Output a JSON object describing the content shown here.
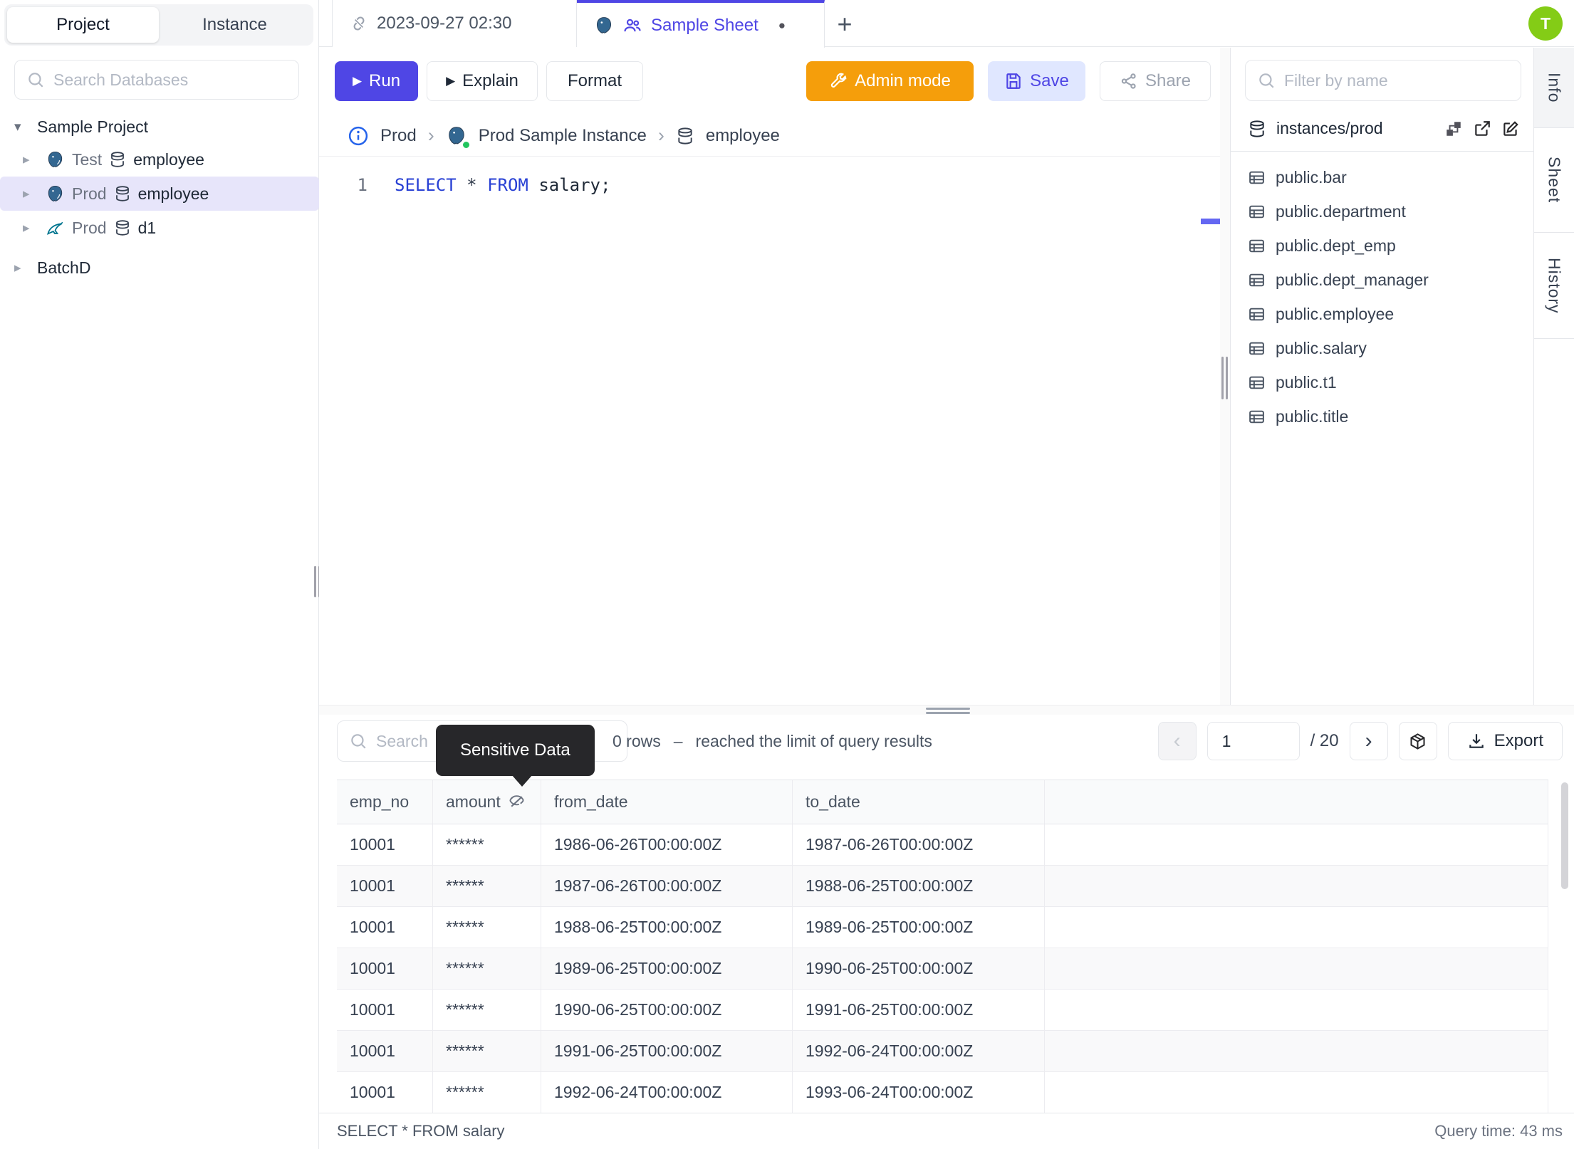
{
  "icons": {
    "play": "▶",
    "plus": "+",
    "caret_down": "▾",
    "caret_right": "▸",
    "chevron": "›",
    "prev": "‹",
    "next": "›",
    "dot": "●"
  },
  "user": {
    "initial": "T"
  },
  "left_sidebar": {
    "tabs": {
      "project": "Project",
      "instance": "Instance"
    },
    "search_placeholder": "Search Databases",
    "tree": {
      "project_label": "Sample Project",
      "items": [
        {
          "engine": "postgresql",
          "env": "Test",
          "db": "employee"
        },
        {
          "engine": "postgresql",
          "env": "Prod",
          "db": "employee"
        },
        {
          "engine": "mysql",
          "env": "Prod",
          "db": "d1"
        }
      ],
      "batch_label": "BatchD"
    }
  },
  "tab_bar": {
    "tab1": {
      "label": "2023-09-27 02:30"
    },
    "tab2": {
      "label": "Sample Sheet"
    }
  },
  "toolbar": {
    "run": "Run",
    "explain": "Explain",
    "format": "Format",
    "admin_mode": "Admin mode",
    "save": "Save",
    "share": "Share"
  },
  "breadcrumb": {
    "env": "Prod",
    "instance": "Prod Sample Instance",
    "database": "employee"
  },
  "editor": {
    "line_number": "1",
    "kw1": "SELECT",
    "star": "*",
    "kw2": "FROM",
    "rest": "salary;"
  },
  "right_sidebar": {
    "filter_placeholder": "Filter by name",
    "scope": "instances/prod",
    "tables": [
      "public.bar",
      "public.department",
      "public.dept_emp",
      "public.dept_manager",
      "public.employee",
      "public.salary",
      "public.t1",
      "public.title"
    ]
  },
  "side_tabs": {
    "info": "Info",
    "sheet": "Sheet",
    "history": "History"
  },
  "results": {
    "search_placeholder": "Search",
    "tooltip": "Sensitive Data",
    "row_count": "0 rows",
    "dash": "–",
    "limit_note": "reached the limit of query results",
    "page": "1",
    "page_total": "/ 20",
    "export_label": "Export",
    "columns": [
      "emp_no",
      "amount",
      "from_date",
      "to_date"
    ],
    "rows": [
      [
        "10001",
        "******",
        "1986-06-26T00:00:00Z",
        "1987-06-26T00:00:00Z"
      ],
      [
        "10001",
        "******",
        "1987-06-26T00:00:00Z",
        "1988-06-25T00:00:00Z"
      ],
      [
        "10001",
        "******",
        "1988-06-25T00:00:00Z",
        "1989-06-25T00:00:00Z"
      ],
      [
        "10001",
        "******",
        "1989-06-25T00:00:00Z",
        "1990-06-25T00:00:00Z"
      ],
      [
        "10001",
        "******",
        "1990-06-25T00:00:00Z",
        "1991-06-25T00:00:00Z"
      ],
      [
        "10001",
        "******",
        "1991-06-25T00:00:00Z",
        "1992-06-24T00:00:00Z"
      ],
      [
        "10001",
        "******",
        "1992-06-24T00:00:00Z",
        "1993-06-24T00:00:00Z"
      ]
    ]
  },
  "status_bar": {
    "query": "SELECT * FROM salary",
    "time": "Query time: 43 ms"
  },
  "colors": {
    "accent": "#4f46e5",
    "admin_orange": "#f59e0b",
    "avatar_green": "#84cc16",
    "selected_tree_bg": "#e7e5fa",
    "tooltip_bg": "#27272a",
    "keyword_blue": "#2840d4"
  }
}
